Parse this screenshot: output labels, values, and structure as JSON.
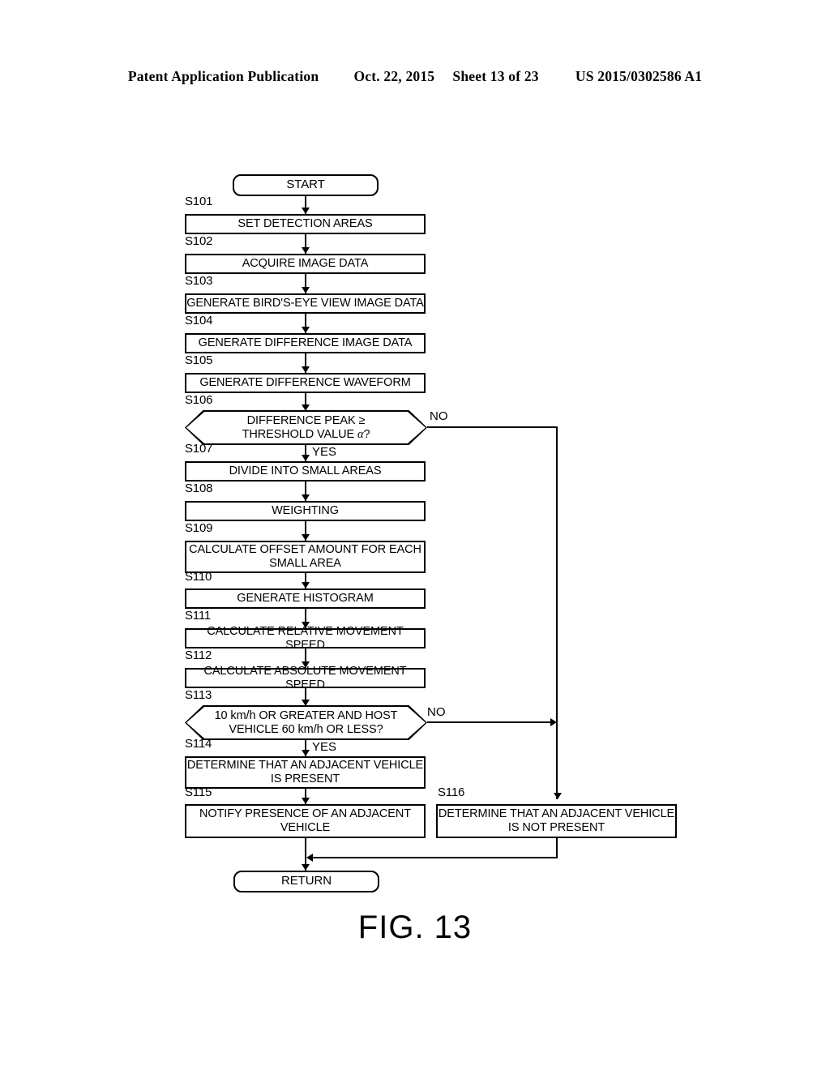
{
  "header": {
    "publication": "Patent Application Publication",
    "date": "Oct. 22, 2015",
    "sheet": "Sheet 13 of 23",
    "patent_number": "US 2015/0302586 A1"
  },
  "figure": {
    "caption": "FIG. 13"
  },
  "flowchart": {
    "start": {
      "label": "START"
    },
    "return": {
      "label": "RETURN"
    },
    "steps": [
      {
        "id": "S101",
        "label": "SET DETECTION AREAS"
      },
      {
        "id": "S102",
        "label": "ACQUIRE IMAGE DATA"
      },
      {
        "id": "S103",
        "label": "GENERATE BIRD'S-EYE VIEW IMAGE DATA"
      },
      {
        "id": "S104",
        "label": "GENERATE DIFFERENCE IMAGE DATA"
      },
      {
        "id": "S105",
        "label": "GENERATE DIFFERENCE WAVEFORM"
      },
      {
        "id": "S106",
        "label_line1": "DIFFERENCE PEAK ≥",
        "label_line2_pre": "THRESHOLD VALUE ",
        "label_line2_sym": "α",
        "label_line2_post": "?",
        "type": "decision",
        "yes": "YES",
        "no": "NO"
      },
      {
        "id": "S107",
        "label": "DIVIDE INTO SMALL AREAS"
      },
      {
        "id": "S108",
        "label": "WEIGHTING"
      },
      {
        "id": "S109",
        "label_line1": "CALCULATE OFFSET AMOUNT FOR EACH",
        "label_line2": "SMALL AREA"
      },
      {
        "id": "S110",
        "label": "GENERATE HISTOGRAM"
      },
      {
        "id": "S111",
        "label": "CALCULATE RELATIVE MOVEMENT SPEED"
      },
      {
        "id": "S112",
        "label": "CALCULATE ABSOLUTE MOVEMENT SPEED"
      },
      {
        "id": "S113",
        "label_line1": "10 km/h OR GREATER AND HOST",
        "label_line2": "VEHICLE 60 km/h OR LESS?",
        "type": "decision",
        "yes": "YES",
        "no": "NO"
      },
      {
        "id": "S114",
        "label_line1": "DETERMINE THAT AN ADJACENT VEHICLE",
        "label_line2": "IS PRESENT"
      },
      {
        "id": "S115",
        "label_line1": "NOTIFY PRESENCE OF AN ADJACENT",
        "label_line2": "VEHICLE"
      },
      {
        "id": "S116",
        "label_line1": "DETERMINE THAT AN ADJACENT VEHICLE",
        "label_line2": "IS NOT PRESENT"
      }
    ]
  }
}
